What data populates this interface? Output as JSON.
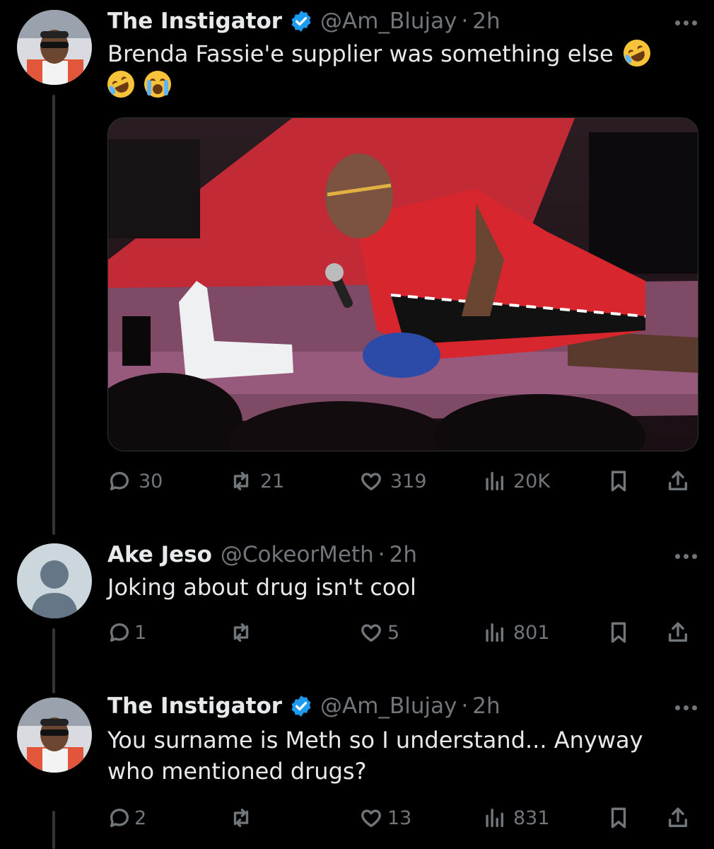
{
  "tweets": [
    {
      "name": "The Instigator",
      "verified": true,
      "handle": "@Am_Blujay",
      "time": "2h",
      "text": "Brenda Fassie'e supplier was something else",
      "emojis": [
        "rolling-on-floor-laughing",
        "rolling-on-floor-laughing",
        "loudly-crying"
      ],
      "counts": {
        "replies": "30",
        "retweets": "21",
        "likes": "319",
        "views": "20K"
      }
    },
    {
      "name": "Ake Jeso",
      "verified": false,
      "handle": "@CokeorMeth",
      "time": "2h",
      "text": "Joking about drug isn't cool",
      "counts": {
        "replies": "1",
        "retweets": "",
        "likes": "5",
        "views": "801"
      }
    },
    {
      "name": "The Instigator",
      "verified": true,
      "handle": "@Am_Blujay",
      "time": "2h",
      "text": "You surname is Meth so I understand... Anyway who mentioned drugs?",
      "counts": {
        "replies": "2",
        "retweets": "",
        "likes": "13",
        "views": "831"
      }
    }
  ],
  "separator": "·",
  "colors": {
    "background": "#000000",
    "primary_text": "#e7e9ea",
    "secondary_text": "#71767b",
    "verified_badge": "#1d9bf0",
    "thread_line": "#333639"
  },
  "icons": [
    "reply-icon",
    "retweet-icon",
    "like-icon",
    "views-icon",
    "bookmark-icon",
    "share-icon",
    "more-icon",
    "verified-icon"
  ]
}
